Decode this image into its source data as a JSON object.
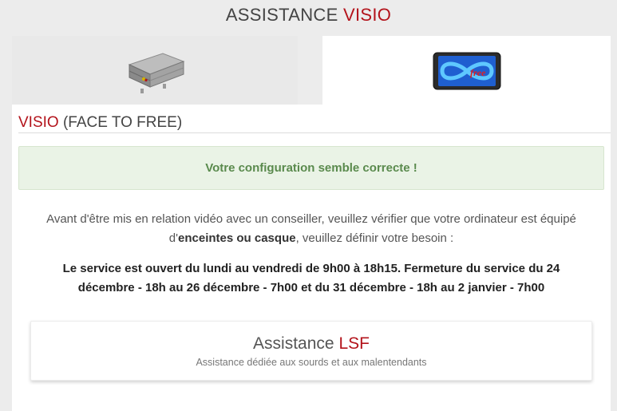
{
  "header": {
    "title_main": "ASSISTANCE ",
    "title_accent": "VISIO"
  },
  "tabs": [
    {
      "icon": "freebox-server-icon",
      "selected": false
    },
    {
      "icon": "free-tablet-icon",
      "selected": true
    }
  ],
  "section": {
    "title_accent": "VISIO",
    "title_rest": " (FACE TO FREE)"
  },
  "alert": {
    "message": "Votre configuration semble correcte !"
  },
  "intro": {
    "part1": "Avant d'être mis en relation vidéo avec un conseiller, veuillez vérifier que votre ordinateur est équipé d'",
    "bold": "enceintes ou casque",
    "part2": ", veuillez définir votre besoin :"
  },
  "hours": {
    "text": "Le service est ouvert du lundi au vendredi de 9h00 à 18h15. Fermeture du service du 24 décembre - 18h au 26 décembre - 7h00 et du 31 décembre - 18h au 2 janvier - 7h00"
  },
  "service_card": {
    "title_main": "Assistance ",
    "title_accent": "LSF",
    "subtitle": "Assistance dédiée aux sourds et aux malentendants"
  },
  "colors": {
    "accent": "#b3131b",
    "alert_bg": "#eaf3e6",
    "alert_text": "#5a8a4d"
  }
}
